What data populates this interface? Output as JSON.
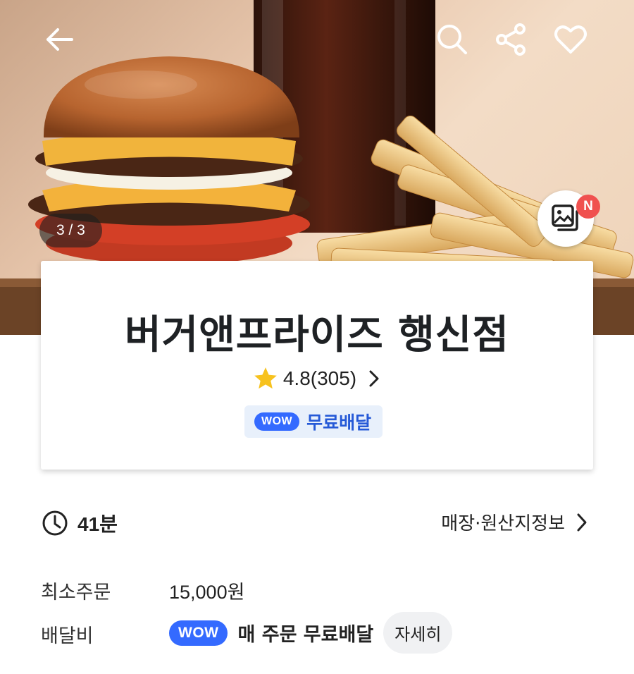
{
  "header": {
    "back_icon": "arrow-left-icon",
    "search_icon": "search-icon",
    "share_icon": "share-icon",
    "favorite_icon": "heart-icon"
  },
  "hero": {
    "image_counter": "3 / 3",
    "gallery_badge": "N"
  },
  "store": {
    "name": "버거앤프라이즈 행신점",
    "rating": "4.8(305)",
    "wow_badge": "WOW",
    "wow_text": "무료배달"
  },
  "info": {
    "delivery_time": "41분",
    "store_info_link": "매장·원산지정보",
    "min_order_label": "최소주문",
    "min_order_value": "15,000원",
    "delivery_fee_label": "배달비",
    "fee_wow_badge": "WOW",
    "fee_text": "매 주문 무료배달",
    "detail_button": "자세히"
  },
  "colors": {
    "accent": "#346aff",
    "badge_red": "#f0514f",
    "star": "#f7c21e"
  }
}
